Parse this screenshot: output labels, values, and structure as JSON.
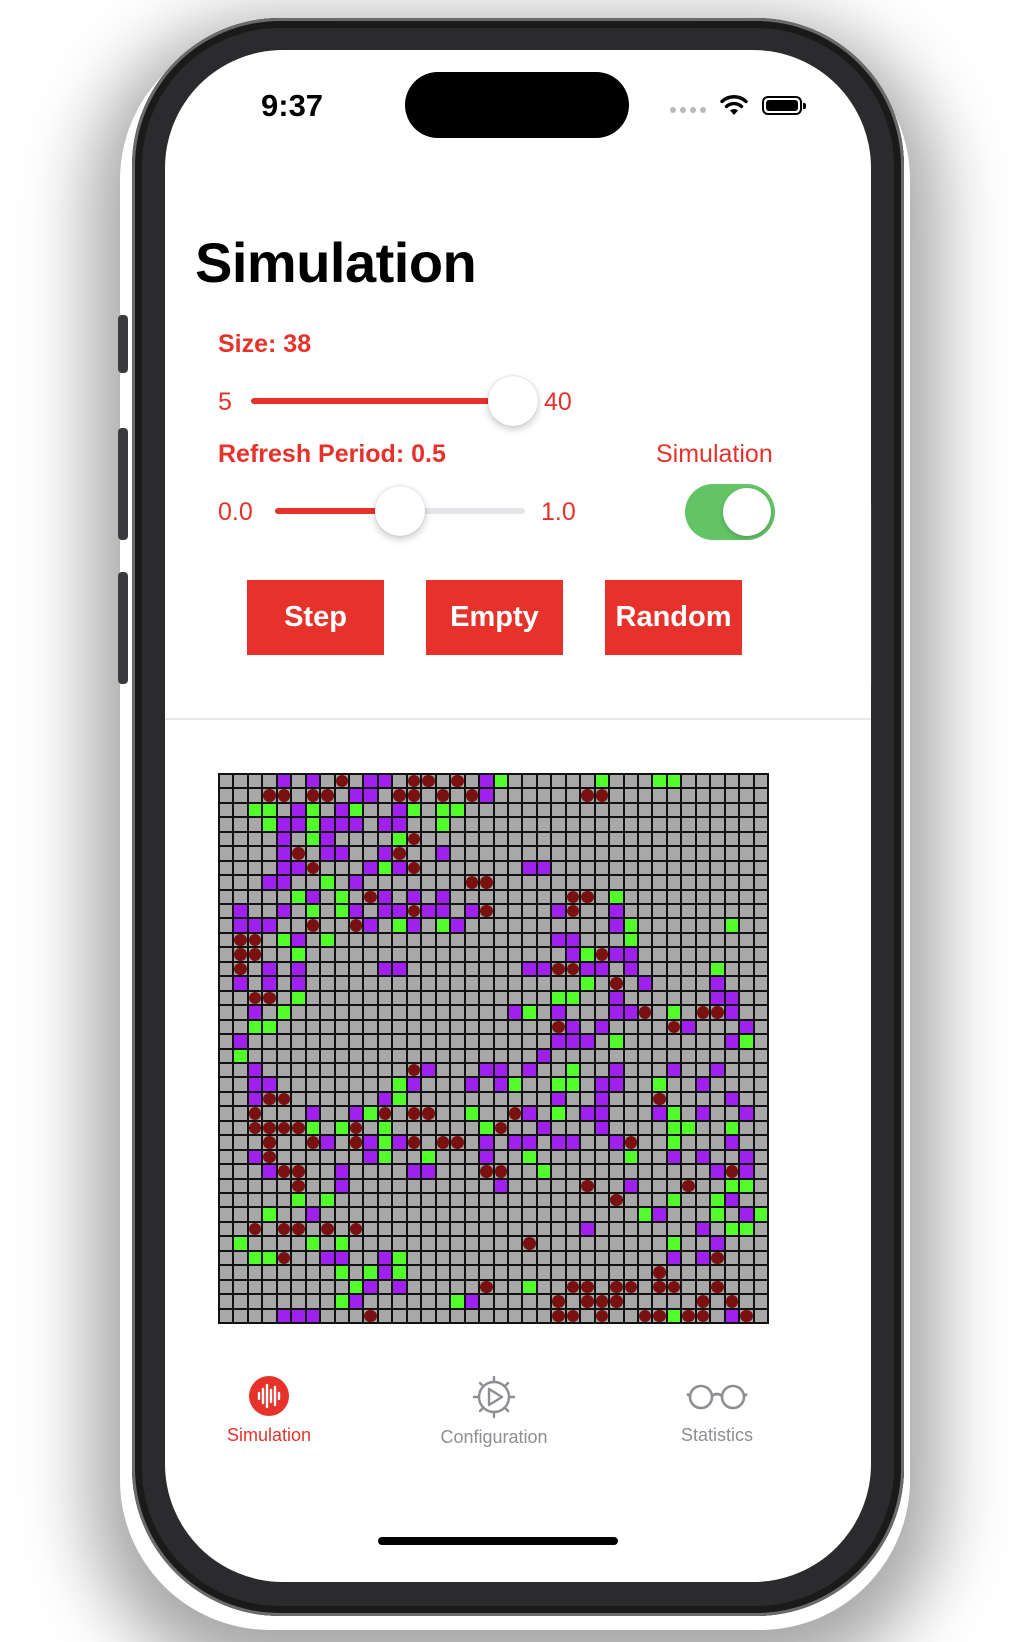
{
  "status_bar": {
    "time": "9:37"
  },
  "page": {
    "title": "Simulation"
  },
  "size_control": {
    "label": "Size: 38",
    "min_label": "5",
    "max_label": "40",
    "value": 38,
    "min": 5,
    "max": 40
  },
  "refresh_control": {
    "label": "Refresh Period: 0.5",
    "min_label": "0.0",
    "max_label": "1.0",
    "value": 0.5,
    "min": 0,
    "max": 1
  },
  "simulation_toggle": {
    "label": "Simulation",
    "on": true
  },
  "buttons": {
    "step": "Step",
    "empty": "Empty",
    "random": "Random"
  },
  "grid": {
    "size": 38,
    "legend": {
      "g": "#53ff2b",
      "p": "#a020f0",
      "d": "#7a1010",
      ".": "#a8a8a8"
    },
    "rows": [
      "....p.p.d.pp.dd.d.pg......g...gg......",
      "...dd.dd.pp.dd.d.dp......dd...........",
      "..gg.pg.pg..pg.gg.....................",
      "...gppgppp.pp..g......................",
      "....p.gp....gd........................",
      "....pd.pp..pd..p......................",
      "....ppd...pgpd.......pp...............",
      "...pp..g.p.......dd...................",
      ".....gp.g.dp.p.p........dd.g..........",
      ".p..p.g.gp.ppdpp.pd....pd..p..........",
      ".ppp..d..dp.gp.gp..........pg......g..",
      ".dd.gp.g...............pp...g.........",
      ".dd..g..................pgdpp.........",
      ".d.p.p.....pp........ppddpp.p.....g...",
      ".p.p.p...................g.d.p....p...",
      "..dd.g.................gg..p......pp..",
      "..p.g...............pg.p...ppd.g.ddp..",
      "..gg...................dp.p....dp...p.",
      ".p.....................ppp.g.......pg.",
      ".g....................p...............",
      "..p..........dp...pp.p..g..p...p..p...",
      "..pp........gp...p.pg..gg.pp..g..p....",
      "..pdd......pg..........p..p...d....p..",
      "..d...p..pgd.dd..g..dp.g.pp...pg.p..p.",
      "..ddddg.gd.g......gd..p...p....gg..g..",
      "...d..dp.dpgpd.dd.p.pp.pp..pd..g...p..",
      "..pd......pg..g...p..g......g..p.p..p.",
      "...pdd..p....pp...dd..g...........pdp.",
      ".....d..p..........p.....d..p...d..gg.",
      ".....g.g...................d...g..gp..",
      "...g..p......................gp...g.pg",
      "..d.dd.d.d...............p.......p.gg.",
      ".g....g.g............d.........g..p...",
      "..ggd..pp..pg..................p.pd...",
      "........g.gpg.................d.......",
      ".........gp.p.....d..g..dd.dd.dd..d...",
      "........gp......gp.....d.ddd.....d.d..",
      "....ppp...d............dd.d..ddgdd.pd."
    ]
  }
}
